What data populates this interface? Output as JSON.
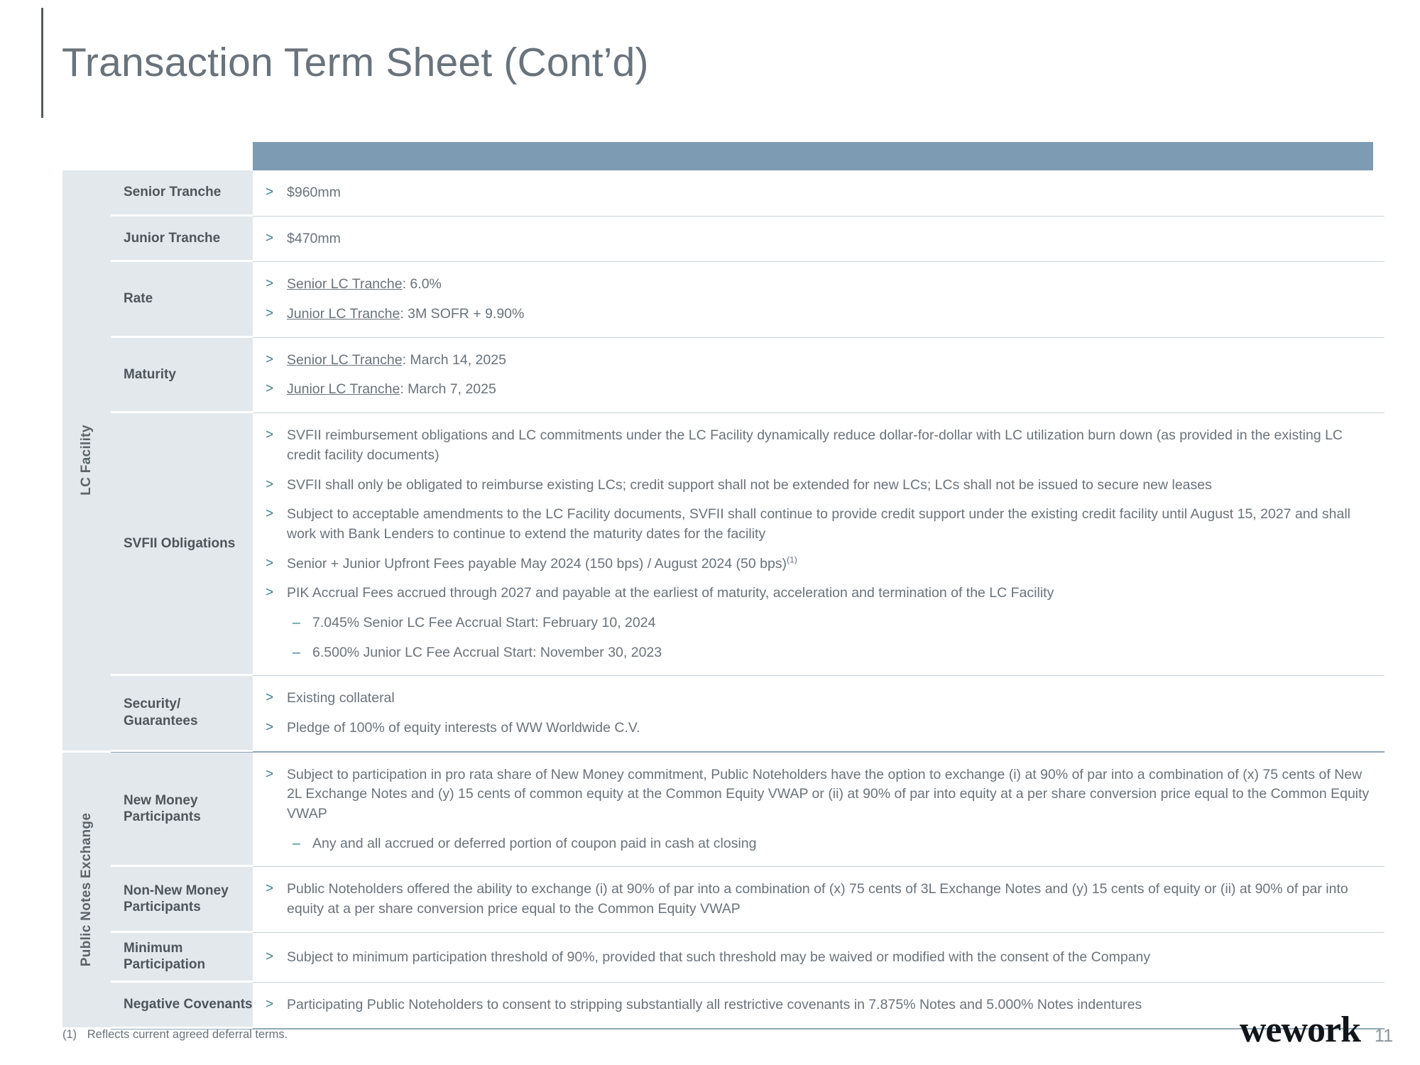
{
  "page_title": "Transaction Term Sheet (Cont’d)",
  "header_band": {
    "label": "",
    "color": "#7d9cb3"
  },
  "colors": {
    "band": "#7d9cb3",
    "label_bg": "#e3e8ec",
    "chevron": "#3d7f8e",
    "text": "#6a737b",
    "title": "#69737c"
  },
  "sections": [
    {
      "name": "LC Facility",
      "rows": [
        {
          "label": "Senior Tranche",
          "items": [
            {
              "type": "bullet",
              "text": "$960mm"
            }
          ]
        },
        {
          "label": "Junior Tranche",
          "items": [
            {
              "type": "bullet",
              "text": "$470mm"
            }
          ]
        },
        {
          "label": "Rate",
          "items": [
            {
              "type": "bullet",
              "underline": "Senior LC Tranche",
              "text": ": 6.0%"
            },
            {
              "type": "bullet",
              "underline": "Junior LC Tranche",
              "text": ": 3M SOFR + 9.90%"
            }
          ]
        },
        {
          "label": "Maturity",
          "items": [
            {
              "type": "bullet",
              "underline": "Senior LC Tranche",
              "text": ": March 14, 2025"
            },
            {
              "type": "bullet",
              "underline": "Junior LC Tranche",
              "text": ": March 7, 2025"
            }
          ]
        },
        {
          "label": "SVFII Obligations",
          "items": [
            {
              "type": "bullet",
              "text": "SVFII reimbursement obligations and LC commitments under the LC Facility dynamically reduce dollar-for-dollar with LC utilization burn down (as provided in the existing LC credit facility documents)"
            },
            {
              "type": "bullet",
              "text": "SVFII shall only be obligated to reimburse existing LCs; credit support shall not be extended for new LCs; LCs shall not be issued to secure new leases"
            },
            {
              "type": "bullet",
              "text": "Subject to acceptable amendments to the LC Facility documents, SVFII shall continue to provide credit support under the existing credit facility until August 15, 2027 and shall work with Bank Lenders to continue to extend the maturity dates for the facility"
            },
            {
              "type": "bullet",
              "text": "Senior + Junior Upfront Fees payable May 2024 (150 bps) / August 2024 (50 bps)",
              "sup": "(1)"
            },
            {
              "type": "bullet",
              "text": "PIK Accrual Fees accrued through 2027 and payable at the earliest of maturity, acceleration and termination of the LC Facility"
            },
            {
              "type": "subbullet",
              "text": "7.045% Senior LC Fee Accrual Start: February 10, 2024"
            },
            {
              "type": "subbullet",
              "text": "6.500% Junior LC Fee Accrual Start: November 30, 2023"
            }
          ]
        },
        {
          "label": "Security/ Guarantees",
          "items": [
            {
              "type": "bullet",
              "text": "Existing collateral"
            },
            {
              "type": "bullet",
              "text": "Pledge of 100% of equity interests of WW Worldwide C.V."
            }
          ]
        }
      ]
    },
    {
      "name": "Public Notes Exchange",
      "rows": [
        {
          "label": "New Money Participants",
          "items": [
            {
              "type": "bullet",
              "text": "Subject to participation in pro rata share of New Money commitment, Public Noteholders have the option to exchange (i) at 90% of par into a combination of (x) 75 cents of New 2L Exchange Notes and (y) 15 cents of common equity at the Common Equity VWAP or (ii) at 90% of par into equity at a per share conversion price equal to the Common Equity VWAP"
            },
            {
              "type": "subbullet",
              "text": "Any and all accrued or deferred portion of coupon paid in cash at closing"
            }
          ]
        },
        {
          "label": "Non-New Money Participants",
          "items": [
            {
              "type": "bullet",
              "text": "Public Noteholders offered the ability to exchange (i) at 90% of par into a combination of (x) 75 cents of 3L Exchange Notes and (y) 15 cents of equity or (ii) at 90% of par into equity at a per share conversion price equal to the Common Equity VWAP"
            }
          ]
        },
        {
          "label": "Minimum Participation",
          "items": [
            {
              "type": "bullet",
              "text": "Subject to minimum participation threshold of 90%, provided that such threshold may be waived or modified with the consent of the Company"
            }
          ]
        },
        {
          "label": "Negative Covenants",
          "items": [
            {
              "type": "bullet",
              "text": "Participating Public Noteholders to consent to stripping substantially all restrictive covenants in 7.875% Notes and 5.000% Notes indentures"
            }
          ]
        }
      ]
    }
  ],
  "footnote": {
    "number": "(1)",
    "text": "Reflects current agreed deferral terms."
  },
  "footer": {
    "logo": "wework",
    "page_number": "11"
  },
  "icons": {
    "bullet": "chevron-right-icon",
    "subbullet": "dash-icon"
  }
}
